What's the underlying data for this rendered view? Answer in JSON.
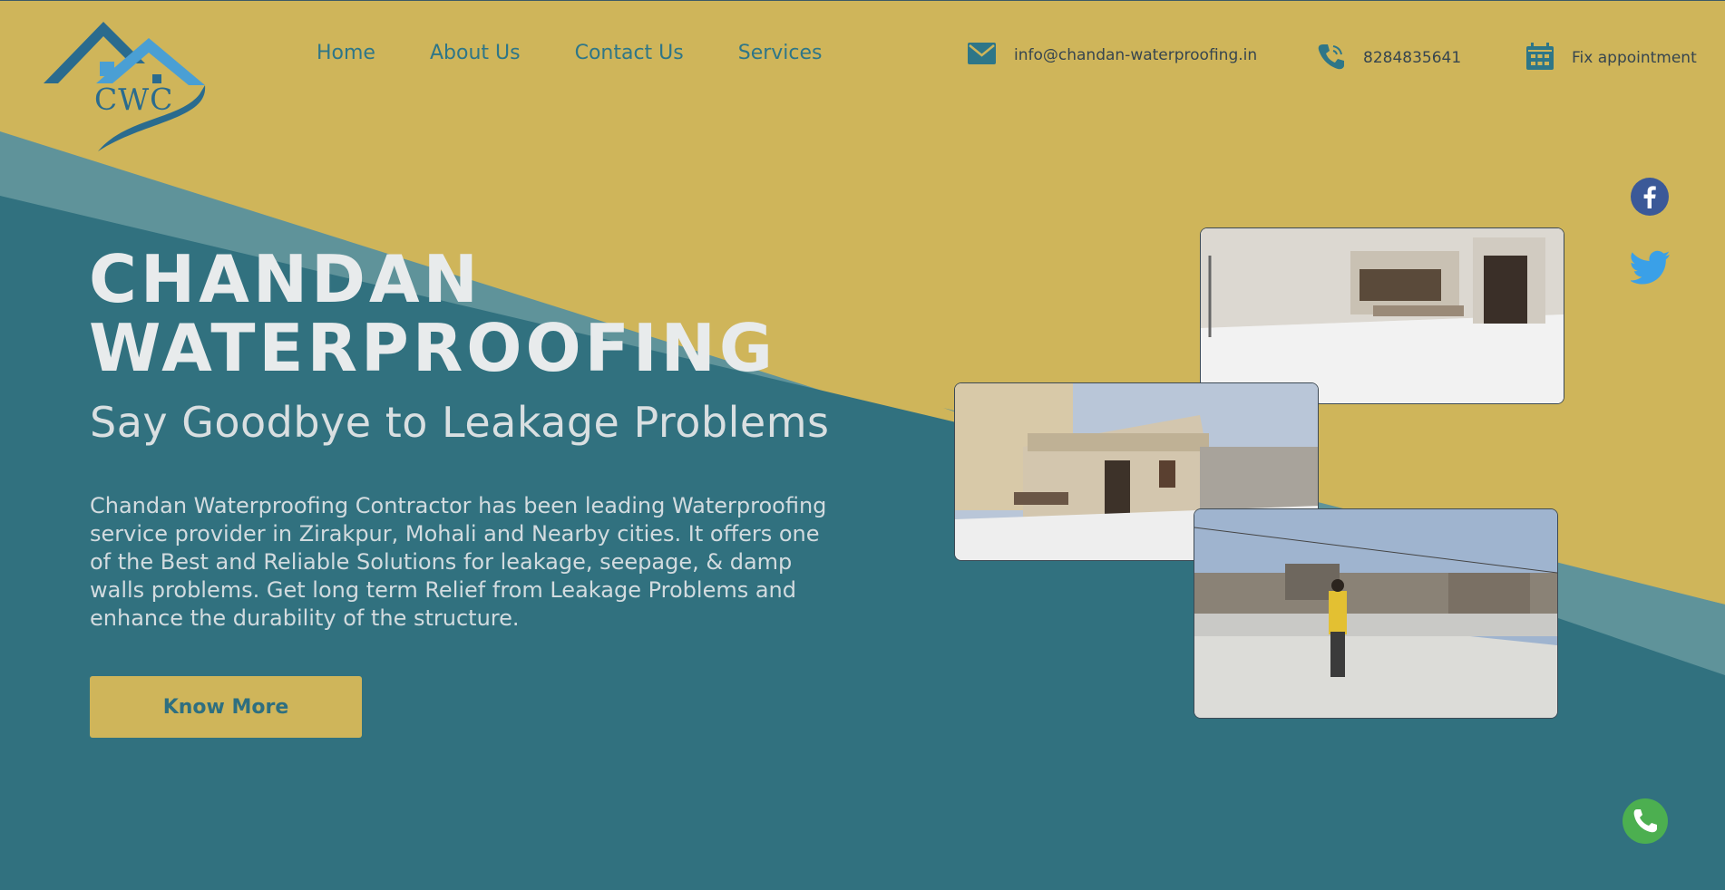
{
  "brand": {
    "logo_text": "CWC",
    "colors": {
      "gold": "#cfb55a",
      "teal": "#31717f",
      "light_teal": "#5f939a",
      "logo_blue": "#2a6b8e"
    }
  },
  "nav": {
    "items": [
      {
        "label": "Home"
      },
      {
        "label": "About Us"
      },
      {
        "label": "Contact Us"
      },
      {
        "label": "Services"
      }
    ]
  },
  "contacts": {
    "email": {
      "icon": "mail-icon",
      "label": "info@chandan-waterproofing.in"
    },
    "phone": {
      "icon": "phone-icon",
      "label": "8284835641"
    },
    "appointment": {
      "icon": "calendar-icon",
      "label": "Fix appointment"
    }
  },
  "social": [
    "facebook-icon",
    "twitter-icon",
    "whatsapp-icon"
  ],
  "hero": {
    "title": "CHANDAN\nWATERPROOFING",
    "subtitle": "Say Goodbye to Leakage Problems",
    "description": "Chandan Waterproofing Contractor has been leading Waterproofing service provider in Zirakpur, Mohali and Nearby cities. It offers one of the Best and Reliable Solutions for leakage, seepage, & damp walls problems. Get long term Relief from Leakage Problems and enhance the durability of the structure.",
    "button_label": "Know More"
  }
}
